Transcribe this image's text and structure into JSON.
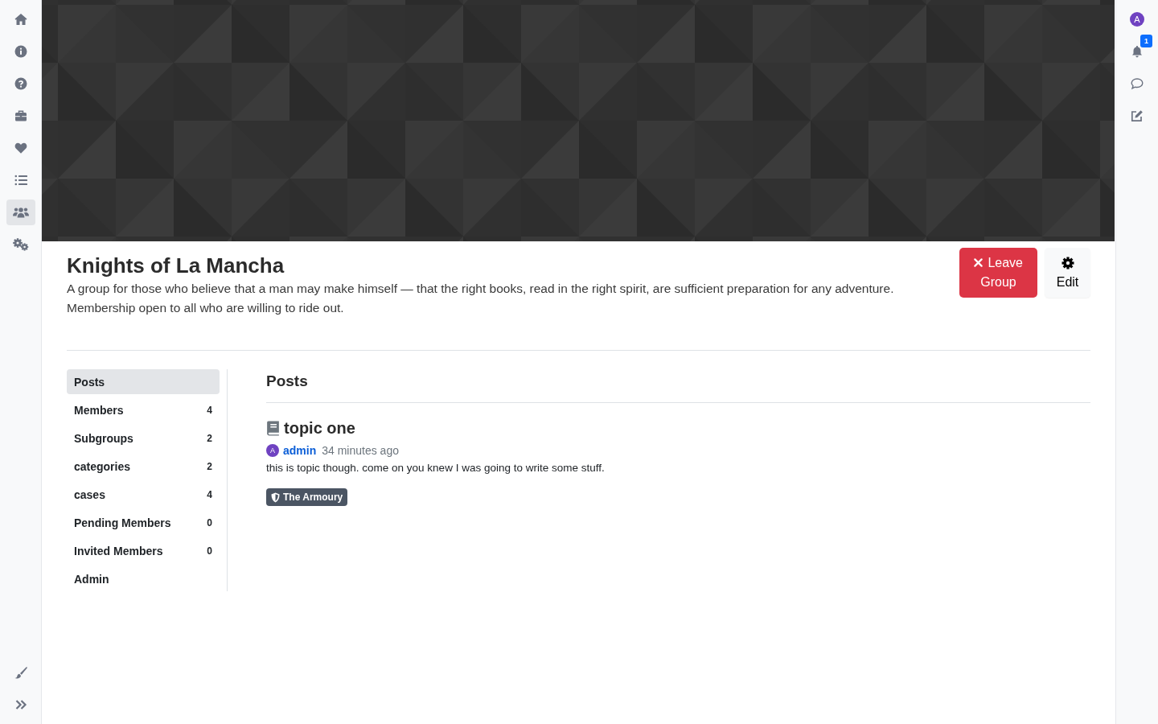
{
  "left_rail": {
    "items": [
      {
        "selected": false
      },
      {
        "selected": false
      },
      {
        "selected": false
      },
      {
        "selected": false
      },
      {
        "selected": false
      },
      {
        "selected": false
      },
      {
        "selected": true
      },
      {
        "selected": false
      }
    ]
  },
  "right_rail": {
    "avatar": "A",
    "notifications": {
      "count": "1"
    }
  },
  "group": {
    "title": "Knights of La Mancha",
    "description": "A group for those who believe that a man may make himself — that the right books, read in the right spirit, are sufficient preparation for any adventure. Membership open to all who are willing to ride out.",
    "actions": [
      {
        "kind": "leave",
        "label": "Leave Group"
      },
      {
        "kind": "edit",
        "label": "Edit"
      }
    ]
  },
  "tabs": [
    {
      "label": "Posts",
      "selected": true
    },
    {
      "label": "Members",
      "count": "4",
      "selected": false
    },
    {
      "label": "Subgroups",
      "count": "2",
      "selected": false
    },
    {
      "label": "categories",
      "count": "2",
      "selected": false
    },
    {
      "label": "cases",
      "count": "4",
      "selected": false
    },
    {
      "label": "Pending Members",
      "count": "0",
      "selected": false
    },
    {
      "label": "Invited Members",
      "count": "0",
      "selected": false
    },
    {
      "label": "Admin",
      "selected": false
    }
  ],
  "posts_section": {
    "heading": "Posts",
    "posts": [
      {
        "title": "topic one",
        "author": {
          "initial": "A",
          "name": "admin"
        },
        "time": "34 minutes ago",
        "body": "this is topic though. come on you knew I was going to write some stuff.",
        "tags": [
          "The Armoury"
        ]
      }
    ]
  }
}
